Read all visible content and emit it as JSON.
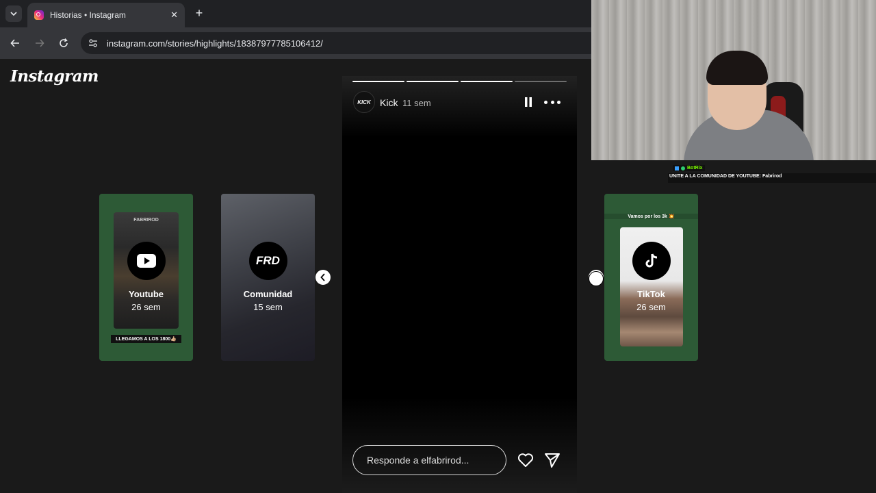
{
  "browser": {
    "tab_title": "Historias • Instagram",
    "tab_close": "✕",
    "new_tab": "+",
    "url": "instagram.com/stories/highlights/18387977785106412/"
  },
  "instagram": {
    "logo": "Instagram"
  },
  "previews": [
    {
      "name": "Youtube",
      "time": "26 sem",
      "icon": "youtube-icon",
      "top_caption": "FABRIROD",
      "bottom_caption": "LLEGAMOS A LOS 1800👍🏼"
    },
    {
      "name": "Comunidad",
      "time": "15 sem",
      "icon": "frd-logo",
      "logo_text": "FRD"
    },
    {
      "name": "TikTok",
      "time": "26 sem",
      "icon": "tiktok-icon",
      "top_caption": "Vamos por los 3k 💥"
    }
  ],
  "story": {
    "user": "Kick",
    "avatar_text": "KICK",
    "time": "11 sem",
    "progress": [
      1,
      1,
      1,
      0
    ],
    "reply_placeholder": "Responde a elfabrirod..."
  },
  "stream_overlay": {
    "bot_name": "BotRix",
    "message": "UNITE A LA COMUNIDAD DE YOUTUBE: Fabrirod"
  },
  "colors": {
    "highlight_green": "#2d5a36",
    "page_bg": "#1a1a1a",
    "story_bg": "#000000"
  }
}
